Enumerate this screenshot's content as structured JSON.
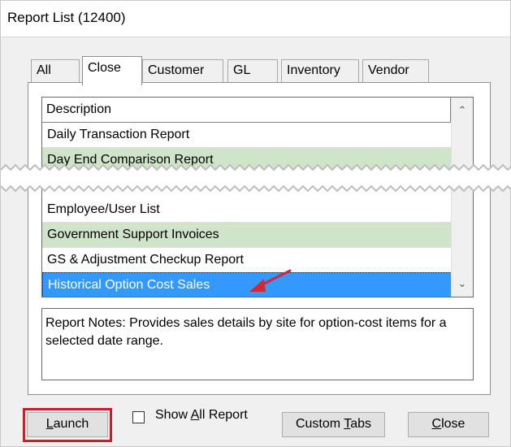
{
  "window": {
    "title": "Report List (12400)"
  },
  "tabs": [
    {
      "label": "All"
    },
    {
      "label": "Close"
    },
    {
      "label": "Customer"
    },
    {
      "label": "GL"
    },
    {
      "label": "Inventory"
    },
    {
      "label": "Vendor"
    }
  ],
  "list": {
    "header": "Description",
    "rows_top": [
      "Daily Transaction Report",
      "Day End Comparison Report"
    ],
    "rows_bottom": [
      "Employee/User List",
      "Government Support Invoices",
      "GS & Adjustment Checkup Report",
      "Historical Option Cost Sales"
    ]
  },
  "notes": {
    "text": "Report Notes:  Provides sales details by site for option-cost items for a selected date range."
  },
  "buttons": {
    "launch_first": "L",
    "launch_rest": "aunch",
    "show_all_a": "Show ",
    "show_all_b": "A",
    "show_all_c": "ll Report",
    "custom_a": "Custom ",
    "custom_b": "T",
    "custom_c": "abs",
    "close_first": "C",
    "close_rest": "lose"
  },
  "colors": {
    "selected": "#3399ff",
    "alt_row": "#cfe4c8",
    "highlight_frame": "#cc2028"
  }
}
